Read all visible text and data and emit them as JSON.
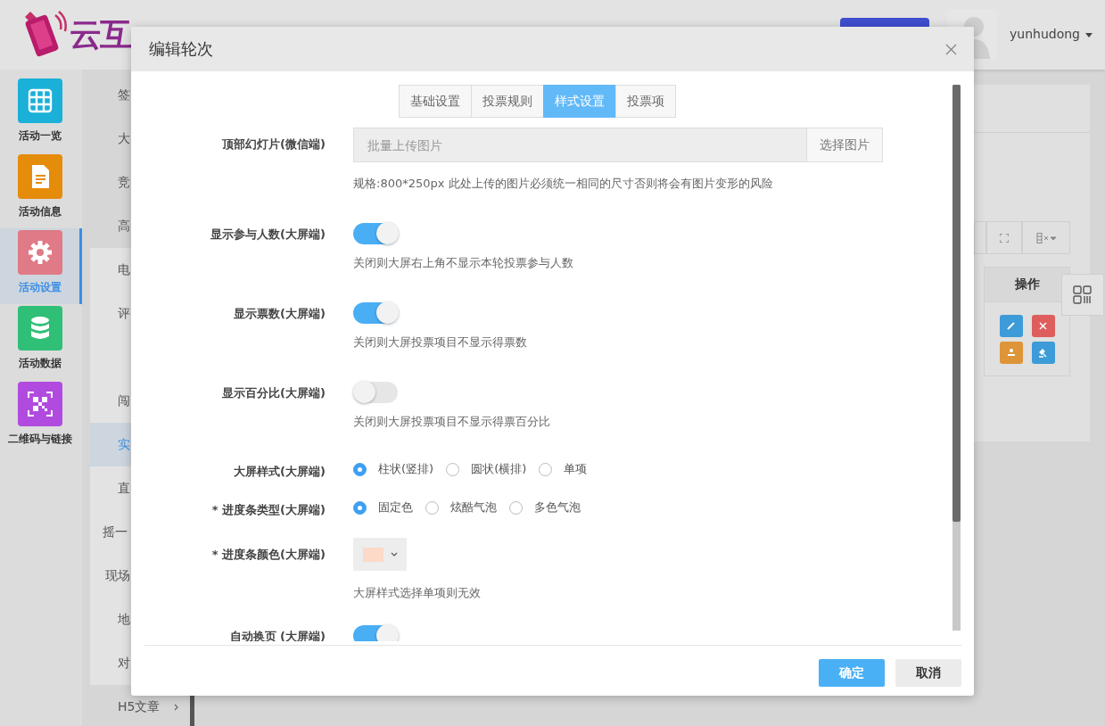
{
  "header": {
    "logo_text": "云互",
    "username": "yunhudong"
  },
  "nav": [
    {
      "label": "活动一览",
      "kind": "grid",
      "color": "#1ab0d8",
      "selected": false
    },
    {
      "label": "活动信息",
      "kind": "document",
      "color": "#e58c0b",
      "selected": false
    },
    {
      "label": "活动设置",
      "kind": "gear",
      "color": "#e07a86",
      "selected": true
    },
    {
      "label": "活动数据",
      "kind": "database",
      "color": "#2fbf77",
      "selected": false
    },
    {
      "label": "二维码与链接",
      "kind": "qrcode",
      "color": "#b14bdf",
      "selected": false
    }
  ],
  "subnav": [
    {
      "label": "签",
      "selected": false
    },
    {
      "label": "大",
      "selected": false
    },
    {
      "label": "竞",
      "selected": false
    },
    {
      "label": "高",
      "selected": false,
      "expanded": true,
      "children": [
        {
          "label": "电",
          "selected": false
        },
        {
          "label": "评",
          "selected": false
        },
        {
          "label": "闯",
          "selected": false
        },
        {
          "label": "实",
          "selected": true
        },
        {
          "label": "直",
          "selected": false
        },
        {
          "label": "摇一",
          "selected": false
        },
        {
          "label": "现场",
          "selected": false
        },
        {
          "label": "地",
          "selected": false
        },
        {
          "label": "对",
          "selected": false
        }
      ]
    },
    {
      "label": "H5文章",
      "selected": false,
      "expanded": false
    }
  ],
  "panel": {
    "table": {
      "columns": [
        "操作"
      ]
    }
  },
  "modal": {
    "title": "编辑轮次",
    "tabs": [
      {
        "label": "基础设置",
        "selected": false
      },
      {
        "label": "投票规则",
        "selected": false
      },
      {
        "label": "样式设置",
        "selected": true
      },
      {
        "label": "投票项",
        "selected": false
      }
    ],
    "fields": [
      {
        "kind": "upload",
        "label": "顶部幻灯片(微信端)",
        "placeholder": "批量上传图片",
        "button": "选择图片",
        "help": "规格:800*250px 此处上传的图片必须统一相同的尺寸否则将会有图片变形的风险"
      },
      {
        "kind": "switch",
        "label": "显示参与人数(大屏端)",
        "on": true,
        "help": "关闭则大屏右上角不显示本轮投票参与人数"
      },
      {
        "kind": "switch",
        "label": "显示票数(大屏端)",
        "on": true,
        "help": "关闭则大屏投票项目不显示得票数"
      },
      {
        "kind": "switch",
        "label": "显示百分比(大屏端)",
        "on": false,
        "help": "关闭则大屏投票项目不显示得票百分比"
      },
      {
        "kind": "radio",
        "label": "大屏样式(大屏端)",
        "options": [
          {
            "label": "柱状(竖排)",
            "selected": true
          },
          {
            "label": "圆状(横排)",
            "selected": false
          },
          {
            "label": "单项",
            "selected": false
          }
        ]
      },
      {
        "kind": "radio",
        "label": "* 进度条类型(大屏端)",
        "options": [
          {
            "label": "固定色",
            "selected": true
          },
          {
            "label": "炫酷气泡",
            "selected": false
          },
          {
            "label": "多色气泡",
            "selected": false
          }
        ]
      },
      {
        "kind": "color",
        "label": "* 进度条颜色(大屏端)",
        "color": "#fdd9c9",
        "help": "大屏样式选择单项则无效"
      },
      {
        "kind": "switch",
        "label": "自动换页 (大屏端)",
        "on": true
      }
    ],
    "buttons": [
      {
        "label": "确定",
        "kind": "primary"
      },
      {
        "label": "取消",
        "kind": "default"
      }
    ]
  }
}
